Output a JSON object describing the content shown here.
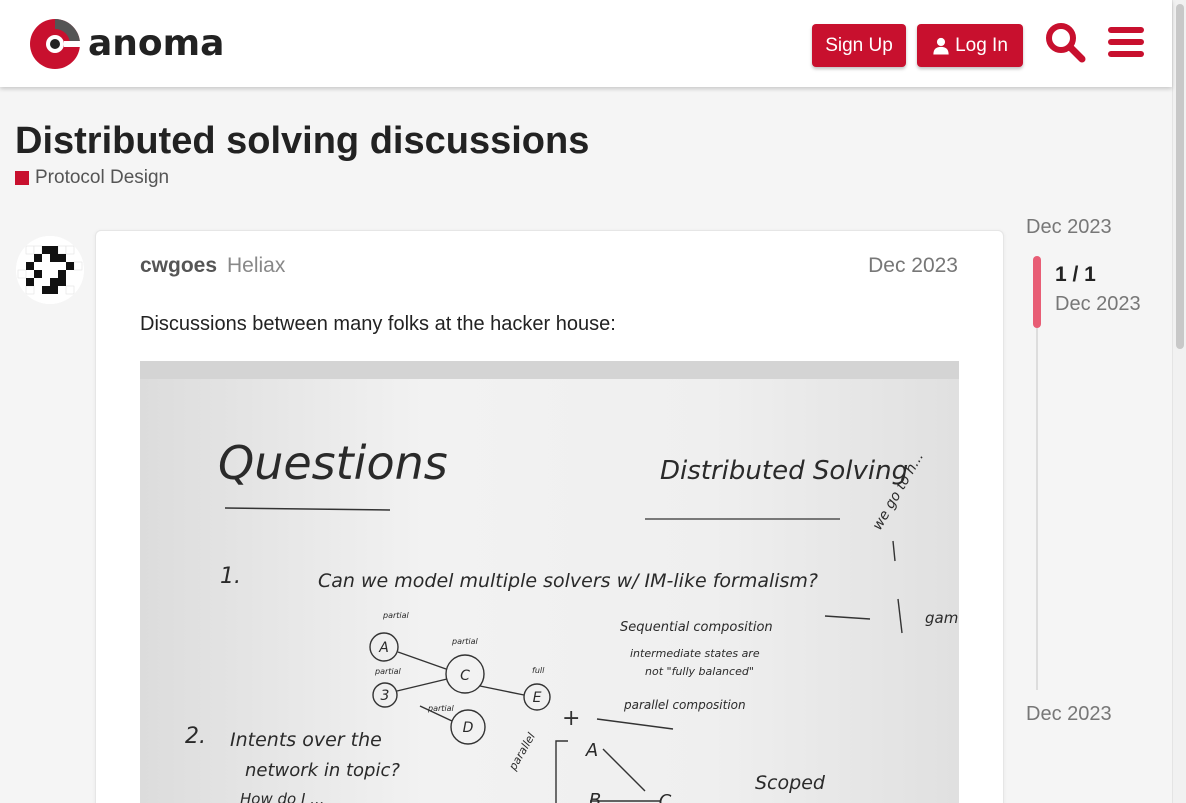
{
  "brand": {
    "name": "anoma",
    "color": "#c8102e"
  },
  "header": {
    "signup_label": "Sign Up",
    "login_label": "Log In"
  },
  "topic": {
    "title": "Distributed solving discussions",
    "category": "Protocol Design",
    "category_color": "#c8102e"
  },
  "post": {
    "username": "cwgoes",
    "user_group": "Heliax",
    "date": "Dec 2023",
    "body_text": "Discussions between many folks at the hacker house:"
  },
  "whiteboard": {
    "heading_left": "Questions",
    "heading_right": "Distributed Solving",
    "q1_number": "1.",
    "q1_text": "Can we model multiple solvers w/ IM-like formalism?",
    "q2_number": "2.",
    "q2_text_line1": "Intents over the",
    "q2_text_line2": "network in topic?",
    "q2_text_line3": "How do I ...",
    "note_sequential": "Sequential composition",
    "note_intermediate1": "intermediate states are",
    "note_intermediate2": "not \"fully balanced\"",
    "note_parallel": "parallel composition",
    "note_scoped": "Scoped",
    "note_right1": "we go to h...",
    "note_right2": "game",
    "node_labels": [
      "A",
      "C",
      "E",
      "3",
      "D",
      "A",
      "B",
      "C"
    ],
    "node_tags": [
      "partial",
      "partial",
      "full",
      "partial",
      "partial",
      "parallel"
    ]
  },
  "timeline": {
    "start_date": "Dec 2023",
    "position": "1 / 1",
    "current_date": "Dec 2023",
    "end_date": "Dec 2023",
    "progress": 1.0
  }
}
